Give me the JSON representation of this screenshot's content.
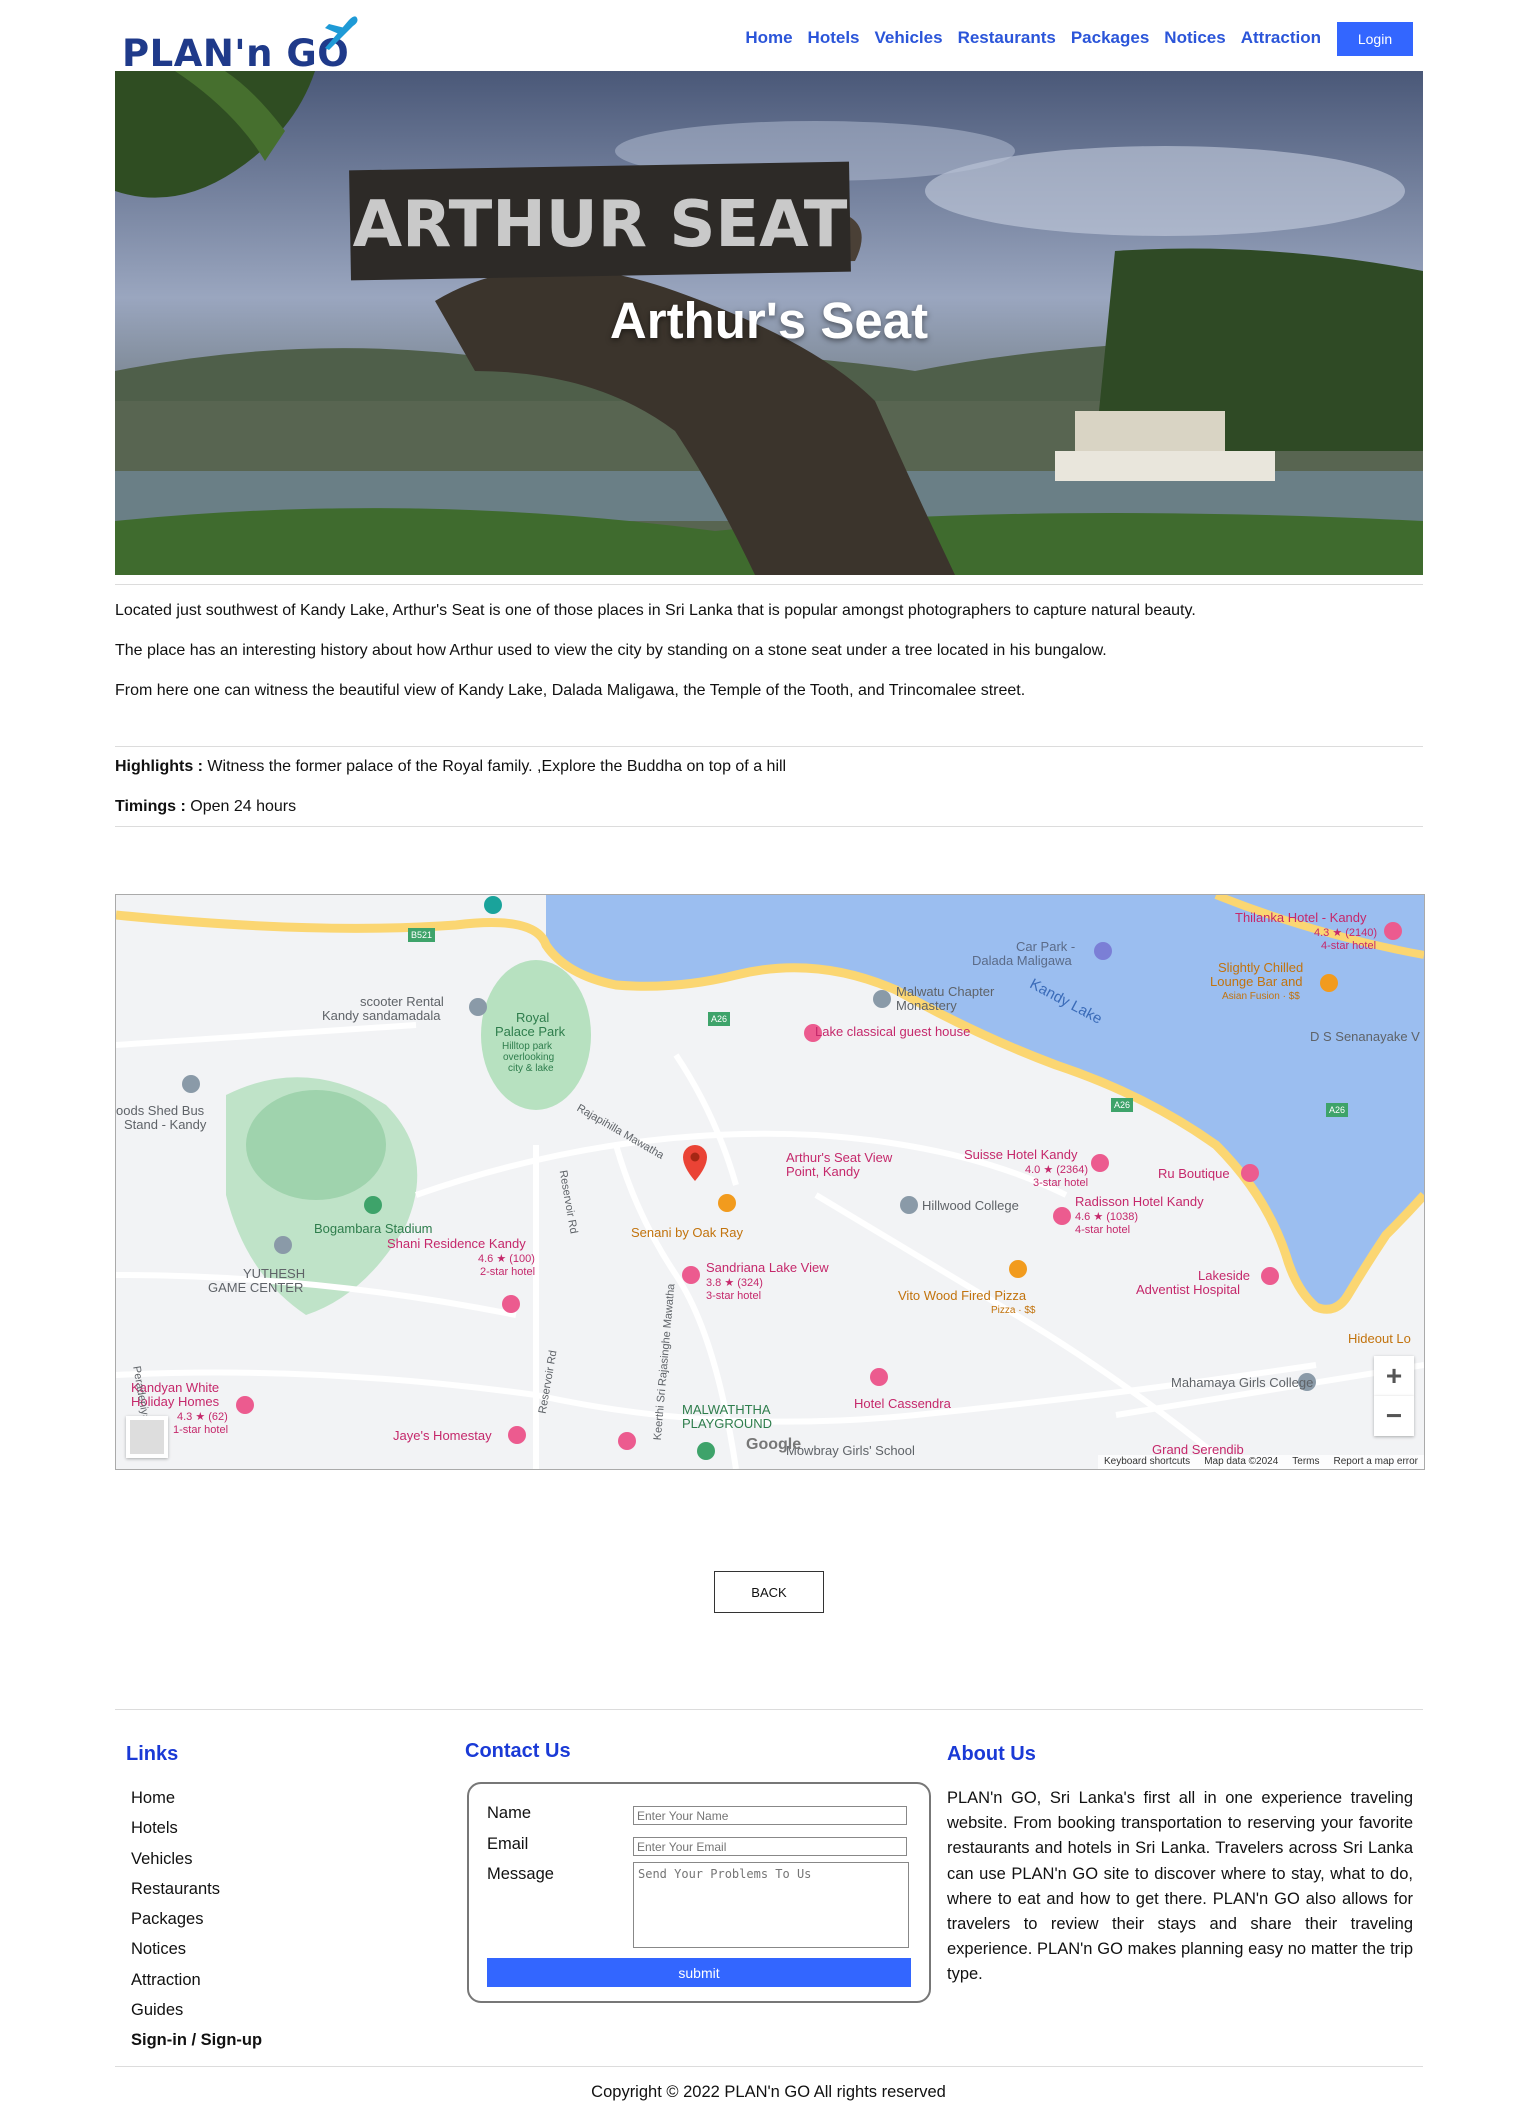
{
  "brand": {
    "logo_text": "PLAN'n GO"
  },
  "nav": {
    "items": [
      "Home",
      "Hotels",
      "Vehicles",
      "Restaurants",
      "Packages",
      "Notices",
      "Attraction"
    ],
    "login_label": "Login"
  },
  "hero": {
    "title": "Arthur's Seat",
    "sign_text": "ARTHUR SEAT"
  },
  "description": [
    "Located just southwest of Kandy Lake, Arthur's Seat is one of those places in Sri Lanka that is popular amongst photographers to capture natural beauty.",
    "The place has an interesting history about how Arthur used to view the city by standing on a stone seat under a tree located in his bungalow.",
    "From here one can witness the beautiful view of Kandy Lake, Dalada Maligawa, the Temple of the Tooth, and Trincomalee street."
  ],
  "details": {
    "highlights_label": "Highlights :",
    "highlights_value": " Witness the former palace of the Royal family. ,Explore the Buddha on top of a hill",
    "timings_label": "Timings :",
    "timings_value": " Open 24 hours"
  },
  "map": {
    "labels": {
      "thilanka": "Thilanka Hotel - Kandy",
      "thilanka_rating": "4.3 ★ (2140)",
      "thilanka_class": "4-star hotel",
      "carpark": "Car Park -",
      "carpark2": "Dalada Maligawa",
      "chilled": "Slightly Chilled",
      "chilled2": "Lounge Bar and",
      "chilled3": "Asian Fusion · $$",
      "scooter": "scooter Rental",
      "scooter2": "Kandy sandamadala",
      "royal": "Royal",
      "royal2": "Palace Park",
      "royal3": "Hilltop park",
      "royal4": "overlooking",
      "royal5": "city & lake",
      "malwatu": "Malwatu Chapter",
      "malwatu2": "Monastery",
      "kandylake": "Kandy Lake",
      "lakeclassical": "Lake classical guest house",
      "dss": "D S Senanayake V",
      "shed": "oods Shed Bus",
      "shed2": "Stand - Kandy",
      "rajapihilla": "Rajapihilla Mawatha",
      "arthur": "Arthur's Seat View",
      "arthur2": "Point, Kandy",
      "suisse": "Suisse Hotel Kandy",
      "suisse_rating": "4.0 ★ (2364)",
      "suisse_class": "3-star hotel",
      "ru": "Ru Boutique",
      "hillwood": "Hillwood College",
      "radisson": "Radisson Hotel Kandy",
      "radisson_rating": "4.6 ★ (1038)",
      "radisson_class": "4-star hotel",
      "senani": "Senani by Oak Ray",
      "bogambara": "Bogambara Stadium",
      "shani": "Shani Residence Kandy",
      "shani_rating": "4.6 ★ (100)",
      "shani_class": "2-star hotel",
      "yuthesh": "YUTHESH",
      "yuthesh2": "GAME CENTER",
      "sandriana": "Sandriana Lake View",
      "sandriana_rating": "3.8 ★ (324)",
      "sandriana_class": "3-star hotel",
      "vitowood": "Vito Wood Fired Pizza",
      "vitowood2": "Pizza · $$",
      "lakeside": "Lakeside",
      "lakeside2": "Adventist Hospital",
      "hideout": "Hideout Lo",
      "mahamaya": "Mahamaya Girls College",
      "kandyan": "Kandyan White",
      "kandyan2": "Holiday Homes",
      "kandyan_rating": "4.3 ★ (62)",
      "kandyan_class": "1-star hotel",
      "jaye": "Jaye's Homestay",
      "malwaththa": "MALWATHTHA",
      "malwaththa2": "PLAYGROUND",
      "cassendra": "Hotel Cassendra",
      "mowbray": "Mowbray Girls' School",
      "grand": "Grand Serendib",
      "reservoir": "Reservoir Rd",
      "keerthi": "Keerthi Sri Rajasinghe Mawatha",
      "peradeniya": "Peradeniya Rd",
      "a26": "A26",
      "b521": "B521"
    },
    "footer": {
      "shortcuts": "Keyboard shortcuts",
      "mapdata": "Map data ©2024",
      "terms": "Terms",
      "report": "Report a map error"
    },
    "google_logo": "Google",
    "zoom_in": "+",
    "zoom_out": "−"
  },
  "back_label": "BACK",
  "footer": {
    "links_title": "Links",
    "links": [
      "Home",
      "Hotels",
      "Vehicles",
      "Restaurants",
      "Packages",
      "Notices",
      "Attraction",
      "Guides",
      "Sign-in / Sign-up"
    ],
    "contact_title": "Contact Us",
    "contact": {
      "name_label": "Name",
      "name_placeholder": "Enter Your Name",
      "email_label": "Email",
      "email_placeholder": "Enter Your Email",
      "message_label": "Message",
      "message_placeholder": "Send Your Problems To Us",
      "submit_label": "submit"
    },
    "about_title": "About Us",
    "about_text": "PLAN'n GO, Sri Lanka's first all in one experience traveling website. From booking transportation to reserving your favorite restaurants and hotels in Sri Lanka. Travelers across Sri Lanka can use PLAN'n GO site to discover where to stay, what to do, where to eat and how to get there. PLAN'n GO also allows for travelers to review their stays and share their traveling experience. PLAN'n GO makes planning easy no matter the trip type.",
    "copyright": "Copyright © 2022 PLAN'n GO All rights reserved"
  },
  "colors": {
    "accent": "#3366ff",
    "nav_link": "#2b55d9",
    "footer_heading": "#1a3ad6",
    "lake": "#9bbef0",
    "road": "#fbd672"
  }
}
